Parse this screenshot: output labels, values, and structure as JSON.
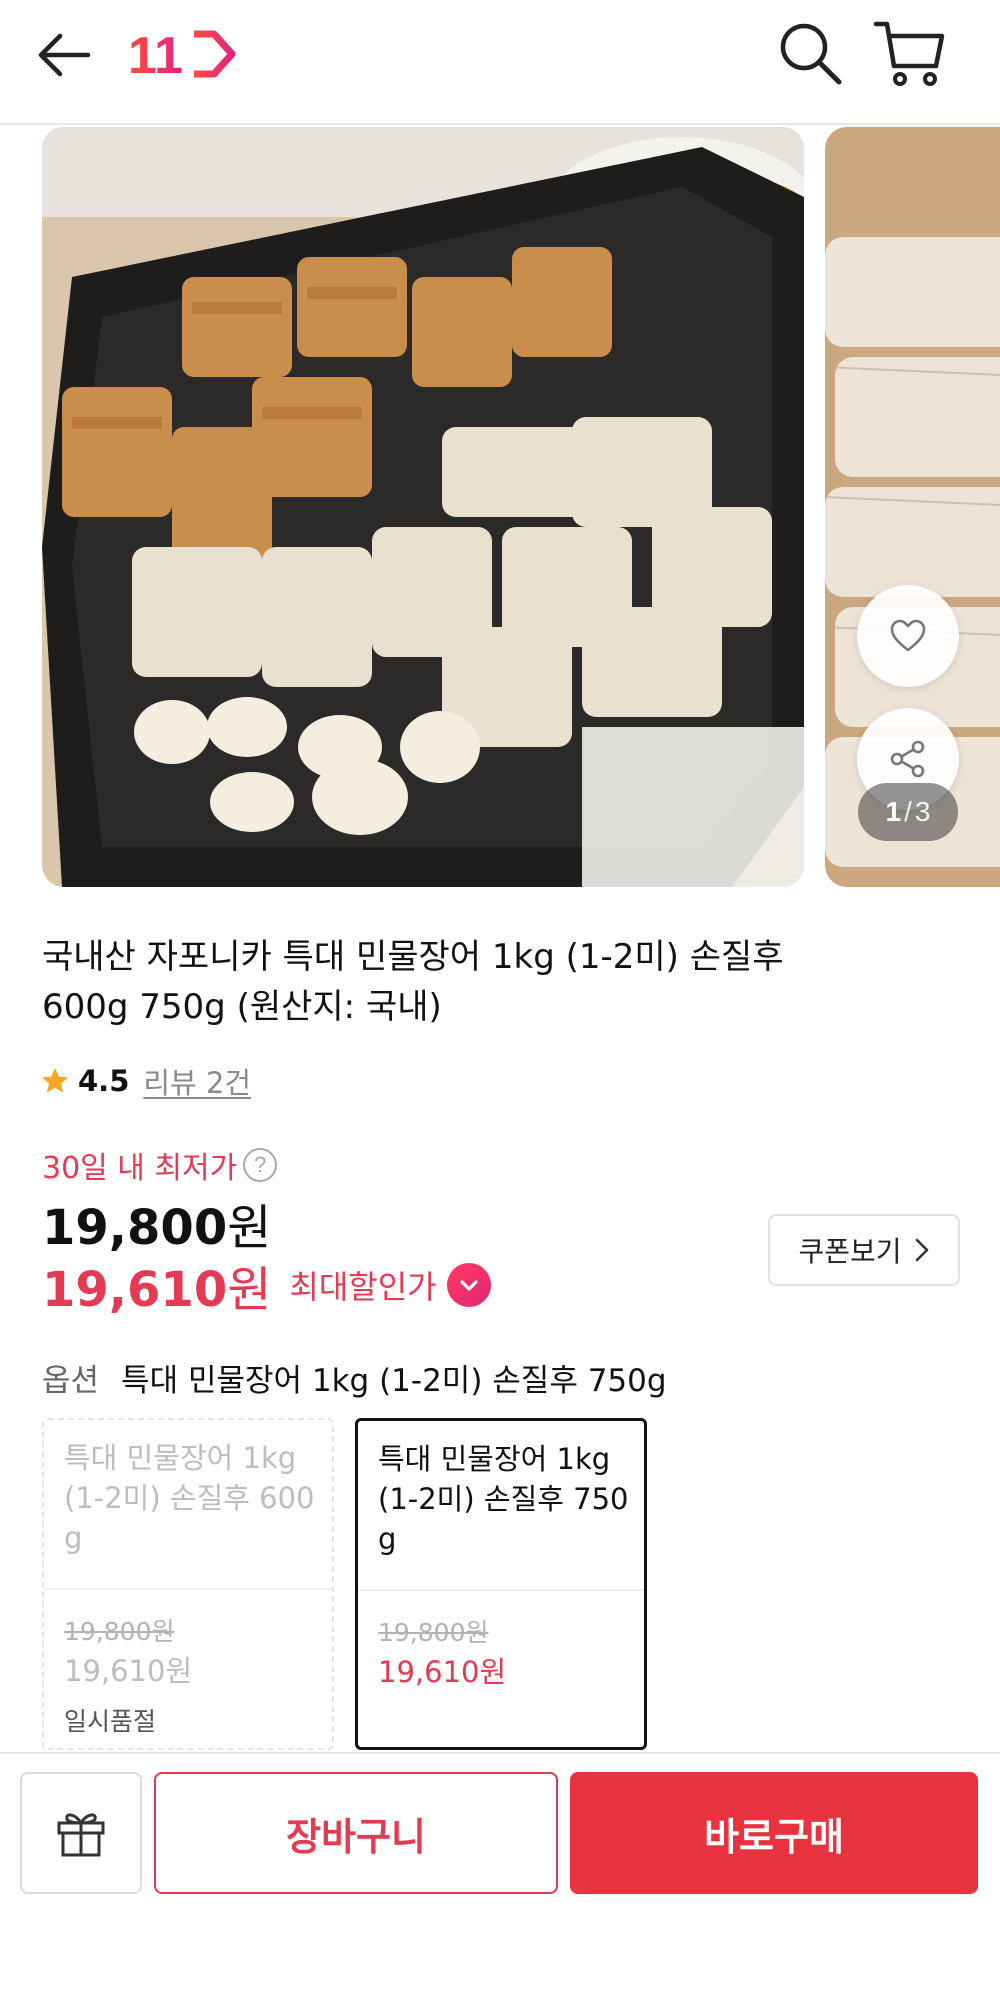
{
  "header": {
    "logo_text": "11",
    "icons": [
      "back-arrow-icon",
      "search-icon",
      "cart-icon"
    ],
    "brand_color": "#ff3b5c"
  },
  "gallery": {
    "current": "1",
    "separator": "/",
    "total": "3",
    "icons": [
      "heart-icon",
      "share-icon"
    ]
  },
  "product": {
    "title_line1": "국내산 자포니카 특대 민물장어 1kg (1-2미) 손질후",
    "title_line2": "600g 750g (원산지: 국내)",
    "rating": "4.5",
    "review_link": "리뷰 2건",
    "lowest_price_label": "30일 내 최저가",
    "help_icon": "?",
    "price_original": "19,800",
    "price_sale": "19,610",
    "currency": "원",
    "max_discount_label": "최대할인가",
    "coupon_button": "쿠폰보기",
    "accent_color": "#e23b53"
  },
  "options": {
    "label": "옵션",
    "selected_value": "특대 민물장어 1kg (1-2미) 손질후 750g",
    "items": [
      {
        "name": "특대 민물장어 1kg (1-2미) 손질후 600g",
        "old_price": "19,800원",
        "price": "19,610원",
        "status": "일시품절"
      },
      {
        "name": "특대 민물장어 1kg (1-2미) 손질후 750g",
        "old_price": "19,800원",
        "price": "19,610원"
      }
    ]
  },
  "bottom_bar": {
    "cart_button": "장바구니",
    "buy_now_button": "바로구매",
    "gift_icon": "gift-icon",
    "buy_color": "#e8323f"
  }
}
